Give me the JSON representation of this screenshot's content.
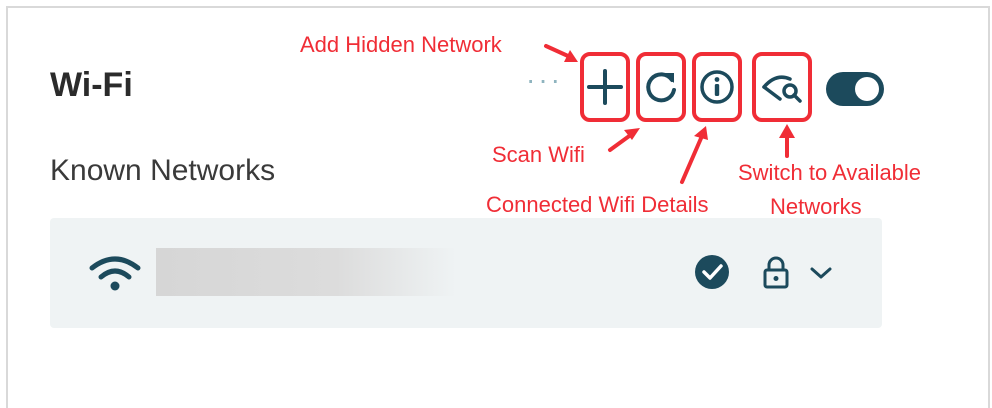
{
  "header": {
    "title": "Wi-Fi",
    "more_label": "···"
  },
  "toolbar": {
    "add_hidden_network_icon": "plus-icon",
    "scan_icon": "refresh-icon",
    "details_icon": "info-icon",
    "switch_icon": "eye-search-icon",
    "toggle_state": "on"
  },
  "section": {
    "title": "Known Networks"
  },
  "network": {
    "name": "",
    "connected": true,
    "secured": true
  },
  "annotations": {
    "add_hidden": "Add Hidden Network",
    "scan": "Scan Wifi",
    "details": "Connected Wifi Details",
    "switch_line1": "Switch to Available",
    "switch_line2": "Networks"
  },
  "colors": {
    "accent": "#1c4a5c",
    "annotation": "#f02d36",
    "panel": "#eff3f4"
  }
}
